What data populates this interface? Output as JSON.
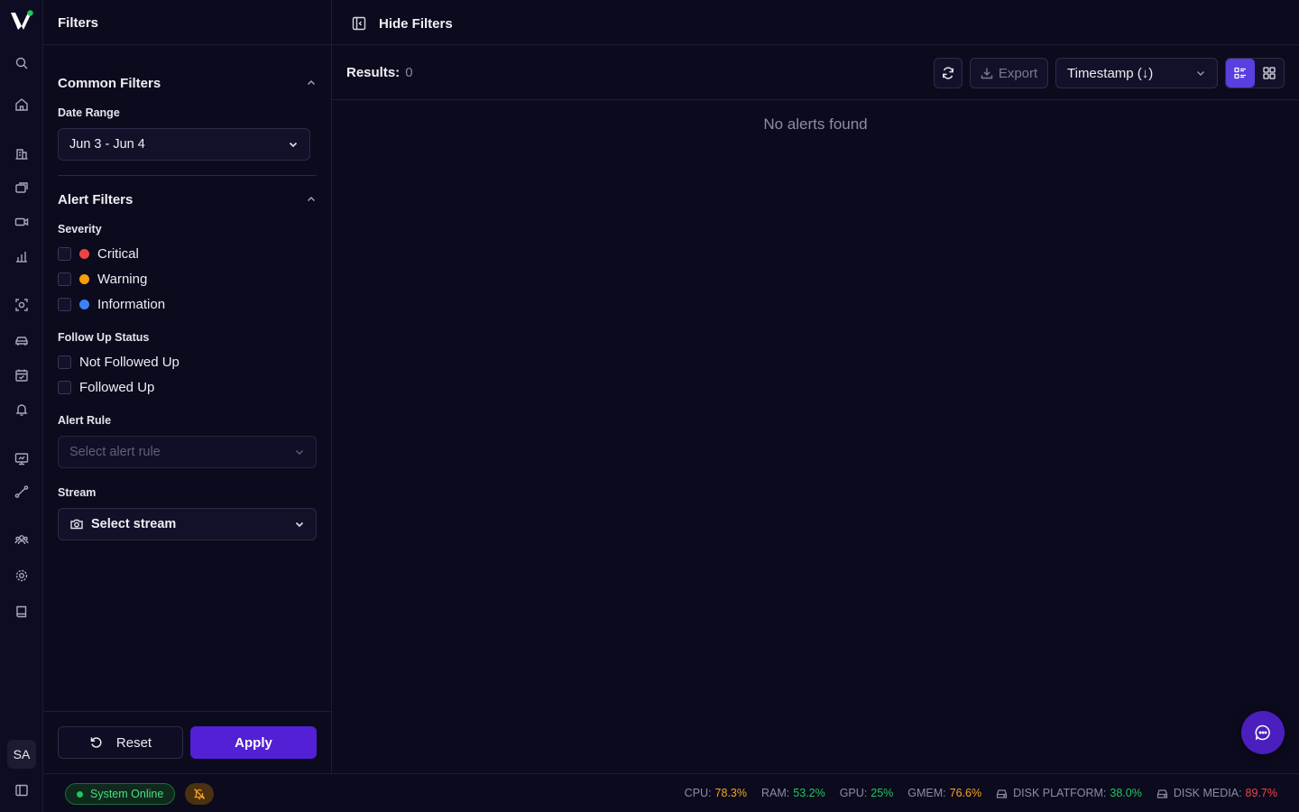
{
  "filters": {
    "title": "Filters",
    "common": {
      "heading": "Common Filters",
      "date_range_label": "Date Range",
      "date_range_value": "Jun 3 - Jun 4"
    },
    "alert": {
      "heading": "Alert Filters",
      "severity_label": "Severity",
      "severity_options": [
        {
          "label": "Critical",
          "color": "#ef4444",
          "checked": false
        },
        {
          "label": "Warning",
          "color": "#f59e0b",
          "checked": false
        },
        {
          "label": "Information",
          "color": "#3b82f6",
          "checked": false
        }
      ],
      "follow_label": "Follow Up Status",
      "follow_options": [
        {
          "label": "Not Followed Up",
          "checked": false
        },
        {
          "label": "Followed Up",
          "checked": false
        }
      ],
      "rule_label": "Alert Rule",
      "rule_placeholder": "Select alert rule",
      "stream_label": "Stream",
      "stream_value": "Select stream"
    },
    "reset_label": "Reset",
    "apply_label": "Apply"
  },
  "topbar": {
    "hide_filters_label": "Hide Filters"
  },
  "results": {
    "label": "Results:",
    "count": "0",
    "export_label": "Export",
    "sort_value": "Timestamp (↓)",
    "active_view": "list",
    "empty_message": "No alerts found"
  },
  "user": {
    "initials": "SA"
  },
  "status": {
    "online_label": "System Online",
    "metrics": [
      {
        "label": "CPU:",
        "value": "78.3%",
        "color": "#f5a524",
        "icon": null
      },
      {
        "label": "RAM:",
        "value": "53.2%",
        "color": "#22c55e",
        "icon": null
      },
      {
        "label": "GPU:",
        "value": "25%",
        "color": "#22c55e",
        "icon": null
      },
      {
        "label": "GMEM:",
        "value": "76.6%",
        "color": "#f5a524",
        "icon": null
      },
      {
        "label": "DISK PLATFORM:",
        "value": "38.0%",
        "color": "#22c55e",
        "icon": "hard-drive-icon"
      },
      {
        "label": "DISK MEDIA:",
        "value": "89.7%",
        "color": "#ef4444",
        "icon": "hard-drive-icon"
      }
    ]
  },
  "rail_icons": [
    "search-icon",
    "home-icon",
    "building-icon",
    "layers-icon",
    "video-camera-icon",
    "bar-chart-icon",
    "scan-face-icon",
    "car-icon",
    "calendar-check-icon",
    "bell-icon",
    "monitor-icon",
    "route-icon",
    "users-icon",
    "settings-icon",
    "book-icon",
    "sidebar-toggle-icon"
  ],
  "colors": {
    "accent": "#5320d6",
    "background": "#0c0a1d"
  }
}
